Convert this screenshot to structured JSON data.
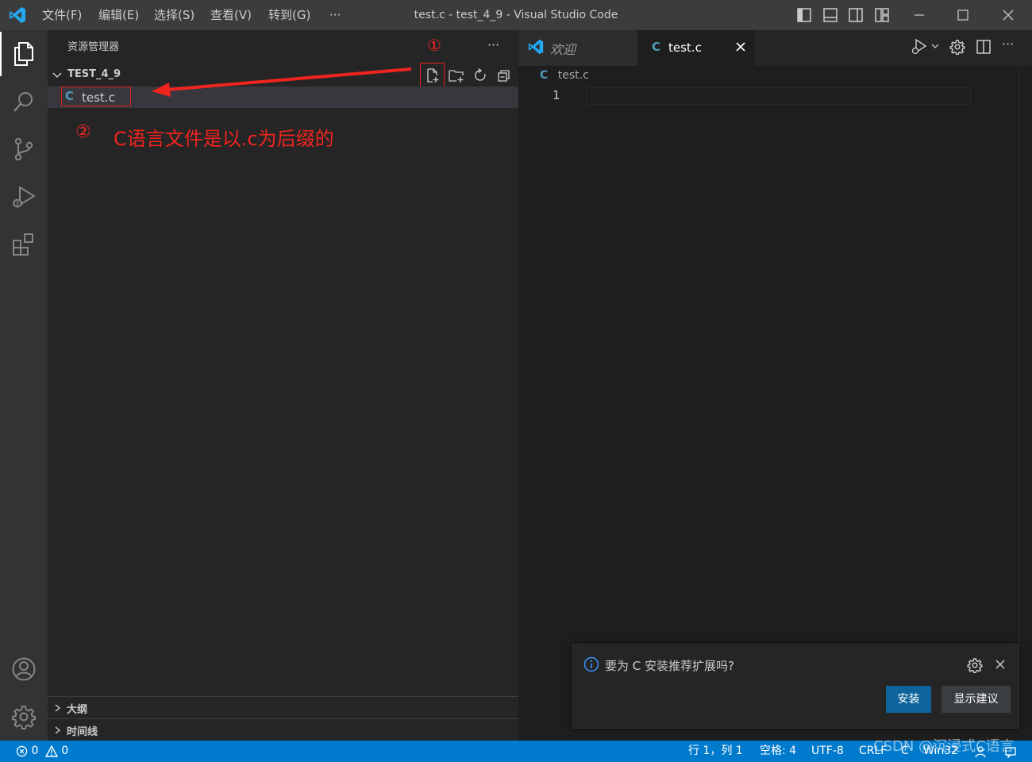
{
  "window": {
    "title": "test.c - test_4_9 - Visual Studio Code",
    "menu": [
      "文件(F)",
      "编辑(E)",
      "选择(S)",
      "查看(V)",
      "转到(G)",
      "···"
    ]
  },
  "sidebar": {
    "title": "资源管理器",
    "more": "···",
    "folder": "TEST_4_9",
    "file": {
      "icon_letter": "C",
      "name": "test.c"
    },
    "panels": [
      "大纲",
      "时间线"
    ]
  },
  "annotations": {
    "marker_1": "①",
    "marker_2": "②",
    "note": "C语言文件是以.c为后缀的"
  },
  "editor": {
    "tabs": [
      {
        "label": "欢迎",
        "active": false
      },
      {
        "icon_letter": "C",
        "label": "test.c",
        "active": true
      }
    ],
    "breadcrumb": {
      "icon_letter": "C",
      "label": "test.c"
    },
    "line_number": "1"
  },
  "notification": {
    "message": "要为 C 安装推荐扩展吗?",
    "install_label": "安装",
    "show_label": "显示建议"
  },
  "statusbar": {
    "errors": "0",
    "warnings": "0",
    "position": "行 1，列 1",
    "spaces": "空格: 4",
    "encoding": "UTF-8",
    "eol": "CRLF",
    "language": "C",
    "platform": "Win32"
  },
  "watermark": "CSDN @沉浸式C语言",
  "colors": {
    "accent": "#007acc",
    "annotation": "#f0241e",
    "c_icon": "#519aba",
    "vscode_blue": "#23a9f2"
  },
  "icons": {
    "activity": [
      "explorer-icon",
      "search-icon",
      "source-control-icon",
      "run-debug-icon",
      "extensions-icon",
      "account-icon",
      "manage-gear-icon"
    ]
  }
}
